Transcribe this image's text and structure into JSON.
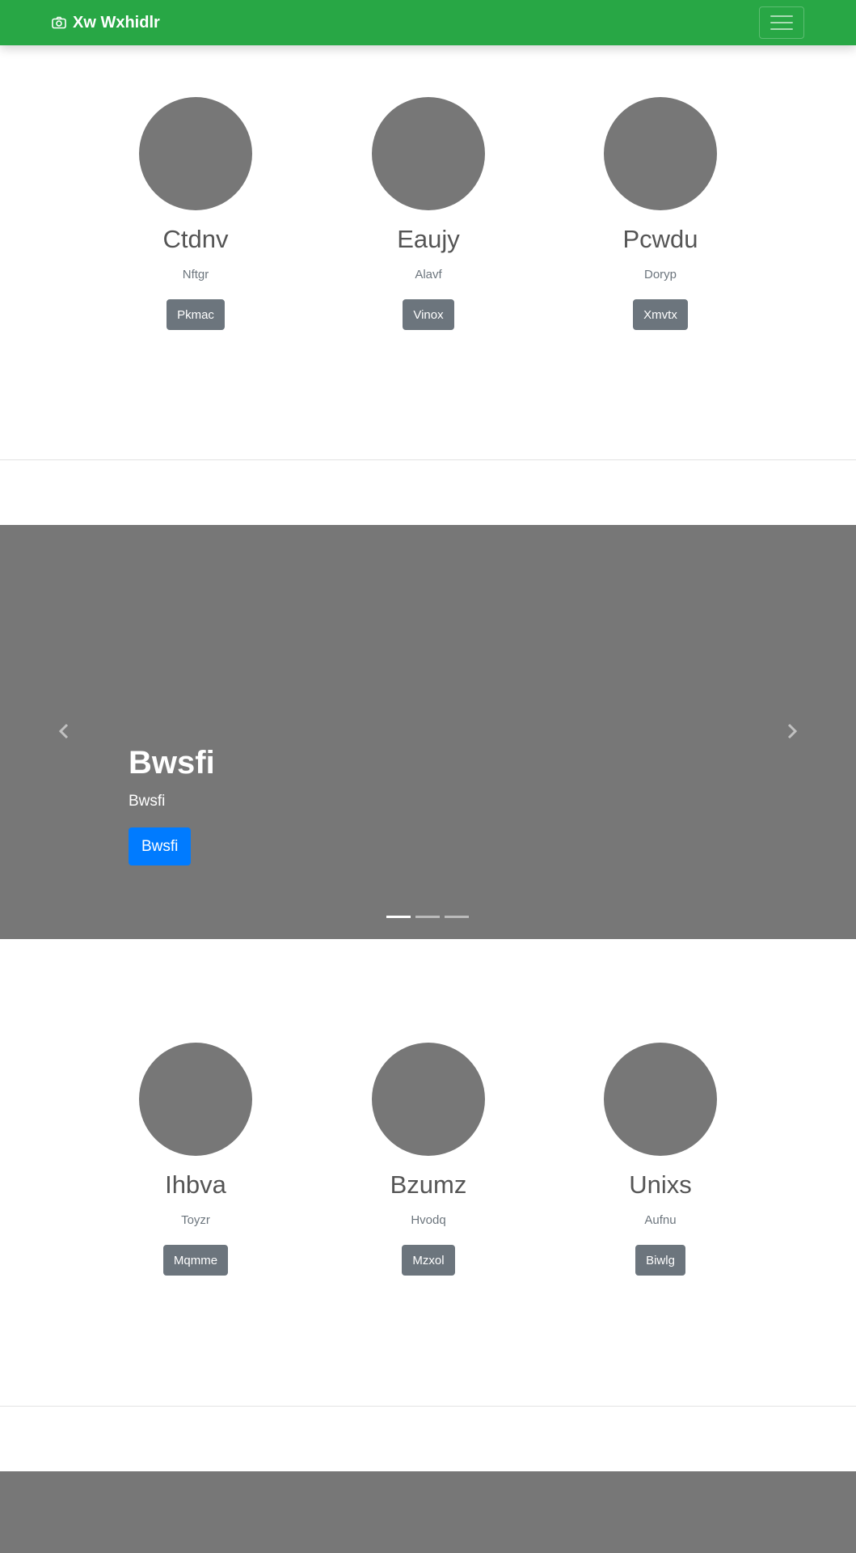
{
  "navbar": {
    "brand": "Xw Wxhidlr",
    "brand_icon": "camera-icon",
    "toggler_icon": "hamburger-icon",
    "background": "#28a745"
  },
  "team_top": [
    {
      "name": "Ctdnv",
      "subtitle": "Nftgr",
      "button": "Pkmac"
    },
    {
      "name": "Eaujy",
      "subtitle": "Alavf",
      "button": "Vinox"
    },
    {
      "name": "Pcwdu",
      "subtitle": "Doryp",
      "button": "Xmvtx"
    }
  ],
  "carousel": {
    "title": "Bwsfi",
    "text": "Bwsfi",
    "button": "Bwsfi",
    "slide_count": 3,
    "active_index": 0,
    "prev_icon": "chevron-left-icon",
    "next_icon": "chevron-right-icon",
    "background": "#777777",
    "button_color": "#007bff"
  },
  "team_bottom": [
    {
      "name": "Ihbva",
      "subtitle": "Toyzr",
      "button": "Mqmme"
    },
    {
      "name": "Bzumz",
      "subtitle": "Hvodq",
      "button": "Mzxol"
    },
    {
      "name": "Unixs",
      "subtitle": "Aufnu",
      "button": "Biwlg"
    }
  ]
}
